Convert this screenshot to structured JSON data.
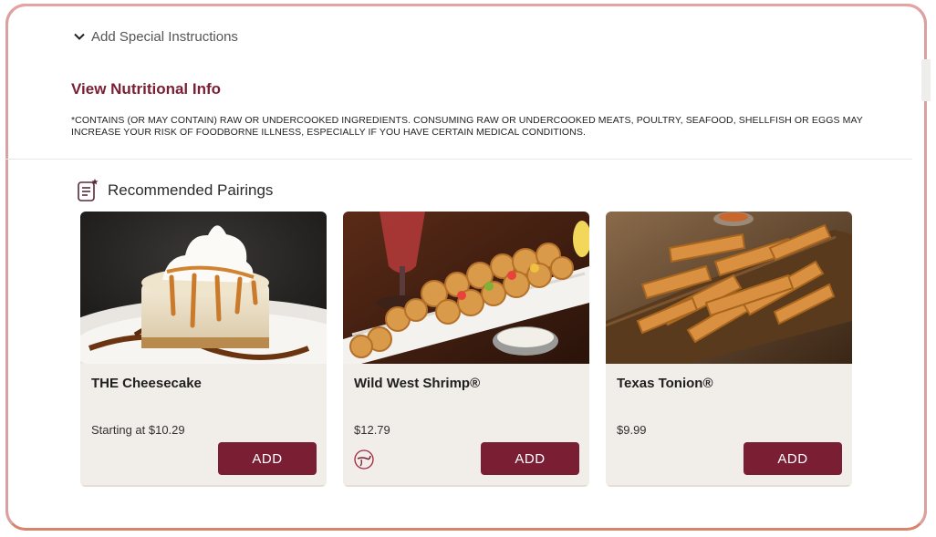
{
  "special_instructions": {
    "label": "Add Special Instructions"
  },
  "nutrition": {
    "link_label": "View Nutritional Info",
    "disclaimer": "*CONTAINS (OR MAY CONTAIN) RAW OR UNDERCOOKED INGREDIENTS. CONSUMING RAW OR UNDERCOOKED MEATS, POULTRY, SEAFOOD, SHELLFISH OR EGGS MAY INCREASE YOUR RISK OF FOODBORNE ILLNESS, ESPECIALLY IF YOU HAVE CERTAIN MEDICAL CONDITIONS."
  },
  "pairings": {
    "title": "Recommended Pairings",
    "icon": "menu-list-icon",
    "items": [
      {
        "name": "THE Cheesecake",
        "price": "Starting at $10.29",
        "add_label": "ADD",
        "image": "cheesecake-photo"
      },
      {
        "name": "Wild West Shrimp®",
        "price": "$12.79",
        "add_label": "ADD",
        "image": "shrimp-photo",
        "badge": "spicy-pepper-icon"
      },
      {
        "name": "Texas Tonion®",
        "price": "$9.99",
        "add_label": "ADD",
        "image": "tonion-photo"
      }
    ]
  },
  "colors": {
    "accent": "#7a1f33",
    "card_bg": "#f1ede8",
    "frame_border": "#d8846a"
  }
}
